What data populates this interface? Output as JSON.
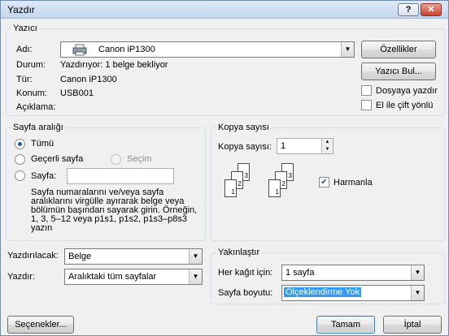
{
  "window": {
    "title": "Yazdır"
  },
  "printer": {
    "group_label": "Yazıcı",
    "name_label": "Adı:",
    "name_value": "Canon iP1300",
    "status_label": "Durum:",
    "status_value": "Yazdırıyor: 1 belge bekliyor",
    "type_label": "Tür:",
    "type_value": "Canon iP1300",
    "location_label": "Konum:",
    "location_value": "USB001",
    "comment_label": "Açıklama:",
    "properties_button": "Özellikler",
    "find_printer_button": "Yazıcı Bul...",
    "print_to_file_label": "Dosyaya yazdır",
    "manual_duplex_label": "El ile çift yönlü",
    "print_to_file_checked": false,
    "manual_duplex_checked": false
  },
  "page_range": {
    "group_label": "Sayfa aralığı",
    "all_label": "Tümü",
    "current_page_label": "Geçerli sayfa",
    "selection_label": "Seçim",
    "pages_label": "Sayfa:",
    "pages_value": "",
    "selected_option": "all",
    "help_text": "Sayfa numaralarını ve/veya sayfa aralıklarını virgülle ayırarak belge veya bölümün başından sayarak girin. Örneğin, 1, 3, 5–12 veya p1s1, p1s2, p1s3–p8s3 yazın"
  },
  "copies": {
    "group_label": "Kopya sayısı",
    "count_label": "Kopya sayısı:",
    "count_value": "1",
    "collate_label": "Harmanla",
    "collate_checked": true,
    "page_numbers": [
      "1",
      "2",
      "3"
    ]
  },
  "print_what": {
    "label": "Yazdırılacak:",
    "value": "Belge"
  },
  "print": {
    "label": "Yazdır:",
    "value": "Aralıktaki tüm sayfalar"
  },
  "zoom": {
    "group_label": "Yakınlaştır",
    "pages_per_sheet_label": "Her kağıt için:",
    "pages_per_sheet_value": "1 sayfa",
    "scale_label": "Sayfa boyutu:",
    "scale_value": "Ölçeklendirme Yok"
  },
  "footer": {
    "options_button": "Seçenekler...",
    "ok_button": "Tamam",
    "cancel_button": "İptal"
  },
  "icons": {
    "help": "help-icon",
    "close": "close-icon",
    "printer": "printer-icon"
  }
}
